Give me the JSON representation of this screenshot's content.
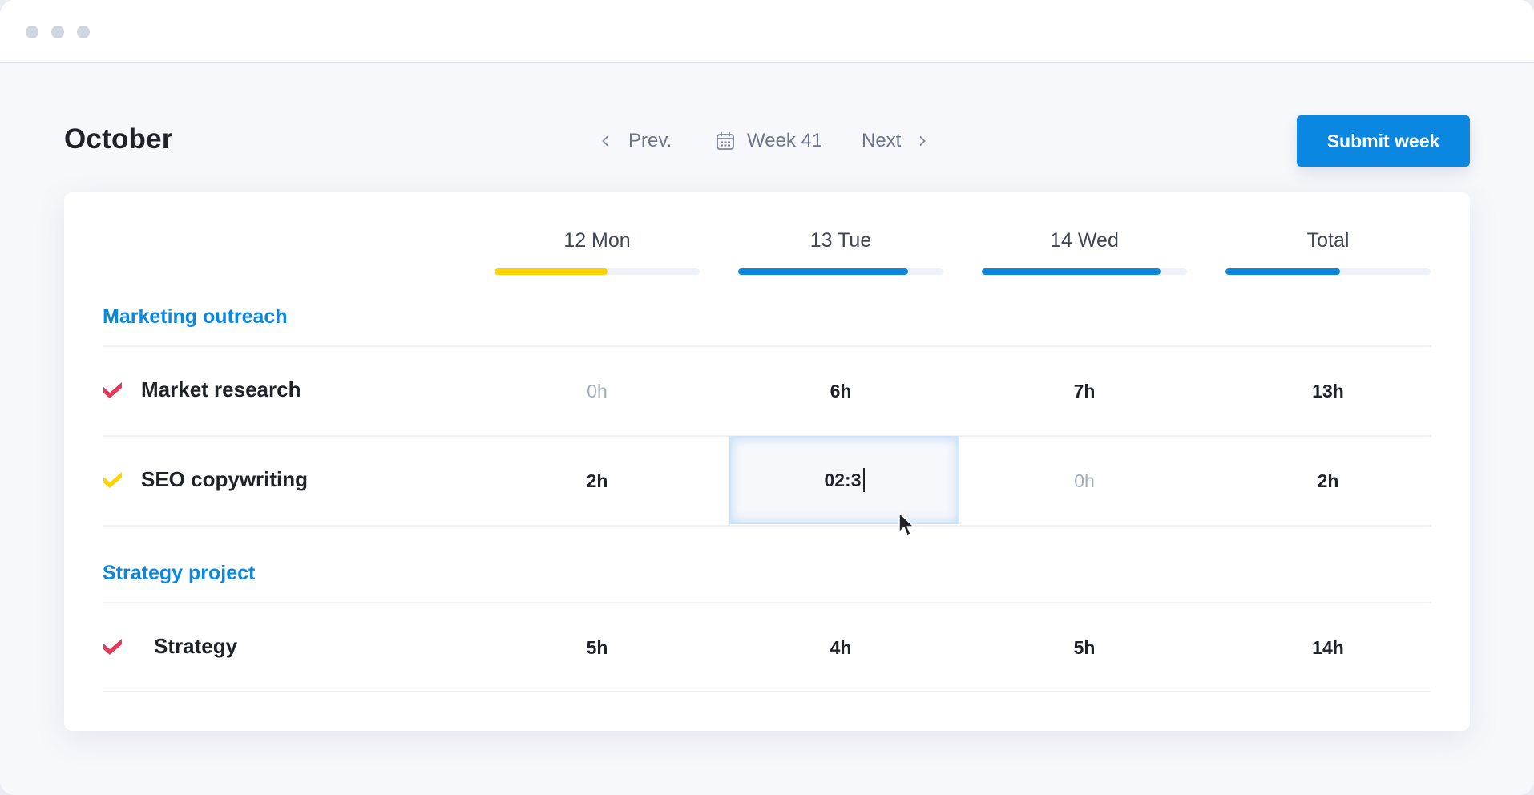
{
  "window": {
    "controls": [
      "close",
      "minimize",
      "maximize"
    ]
  },
  "header": {
    "title": "October",
    "nav": {
      "prev_label": "Prev.",
      "week_label": "Week 41",
      "next_label": "Next",
      "prev_icon": "chevron-left-icon",
      "week_icon": "calendar-icon",
      "next_icon": "chevron-right-icon"
    },
    "submit_label": "Submit week"
  },
  "colors": {
    "accent": "#0a87e0",
    "warning": "#fcd200",
    "danger": "#e23b5e",
    "muted_text": "#a2aabb"
  },
  "columns": [
    {
      "label": "12 Mon",
      "progress": 0.55,
      "color": "#fcd200"
    },
    {
      "label": "13 Tue",
      "progress": 0.83,
      "color": "#0a87e0"
    },
    {
      "label": "14 Wed",
      "progress": 0.87,
      "color": "#0a87e0"
    },
    {
      "label": "Total",
      "progress": 0.56,
      "color": "#0a87e0"
    }
  ],
  "sections": [
    {
      "title": "Marketing outreach",
      "tasks": [
        {
          "name": "Market research",
          "status_color": "#e23b5e",
          "cells": [
            "0h",
            "6h",
            "7h",
            "13h"
          ]
        },
        {
          "name": "SEO copywriting",
          "status_color": "#fcd200",
          "cells": [
            "2h",
            "",
            "0h",
            "2h"
          ],
          "editing": {
            "column": 1,
            "value": "02:3"
          }
        }
      ]
    },
    {
      "title": "Strategy project",
      "tasks": [
        {
          "name": "Strategy",
          "status_color": "#e23b5e",
          "cells": [
            "5h",
            "4h",
            "5h",
            "14h"
          ]
        }
      ]
    }
  ]
}
